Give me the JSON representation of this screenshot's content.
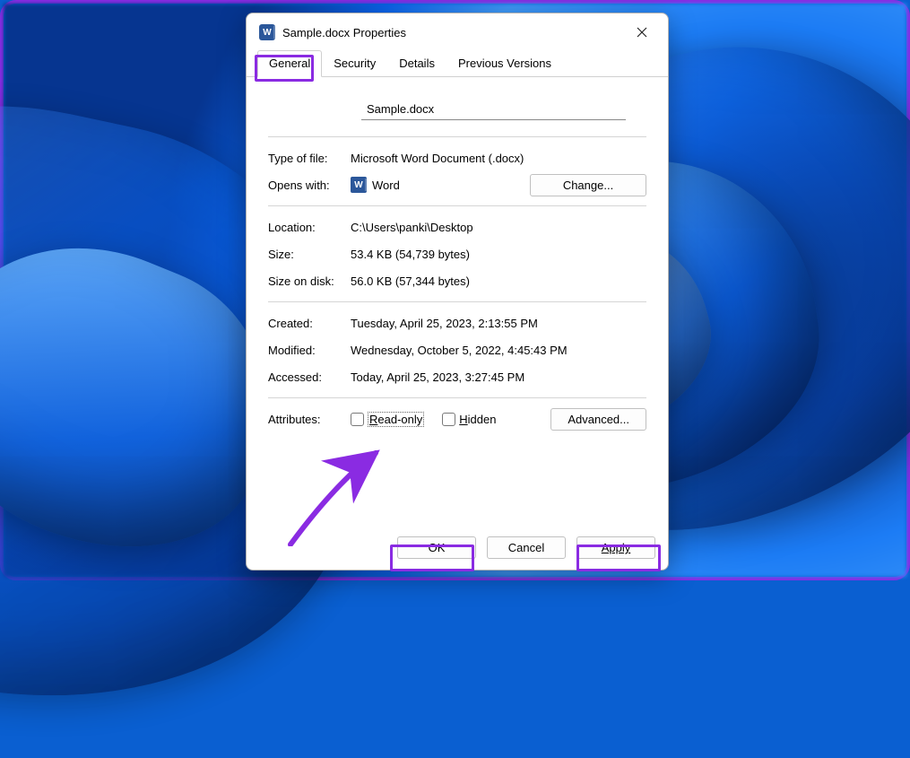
{
  "window": {
    "title": "Sample.docx Properties"
  },
  "tabs": {
    "general": "General",
    "security": "Security",
    "details": "Details",
    "previous": "Previous Versions"
  },
  "filename": "Sample.docx",
  "labels": {
    "type_of_file": "Type of file:",
    "opens_with": "Opens with:",
    "location": "Location:",
    "size": "Size:",
    "size_on_disk": "Size on disk:",
    "created": "Created:",
    "modified": "Modified:",
    "accessed": "Accessed:",
    "attributes": "Attributes:"
  },
  "values": {
    "type_of_file": "Microsoft Word Document (.docx)",
    "opens_with": "Word",
    "location": "C:\\Users\\panki\\Desktop",
    "size": "53.4 KB (54,739 bytes)",
    "size_on_disk": "56.0 KB (57,344 bytes)",
    "created": "Tuesday, April 25, 2023, 2:13:55 PM",
    "modified": "Wednesday, October 5, 2022, 4:45:43 PM",
    "accessed": "Today, April 25, 2023, 3:27:45 PM"
  },
  "buttons": {
    "change": "Change...",
    "advanced": "Advanced...",
    "ok": "OK",
    "cancel": "Cancel",
    "apply": "Apply"
  },
  "attributes": {
    "read_only_prefix": "R",
    "read_only_rest": "ead-only",
    "hidden_prefix": "H",
    "hidden_rest": "idden"
  },
  "icons": {
    "word_letter": "W"
  }
}
